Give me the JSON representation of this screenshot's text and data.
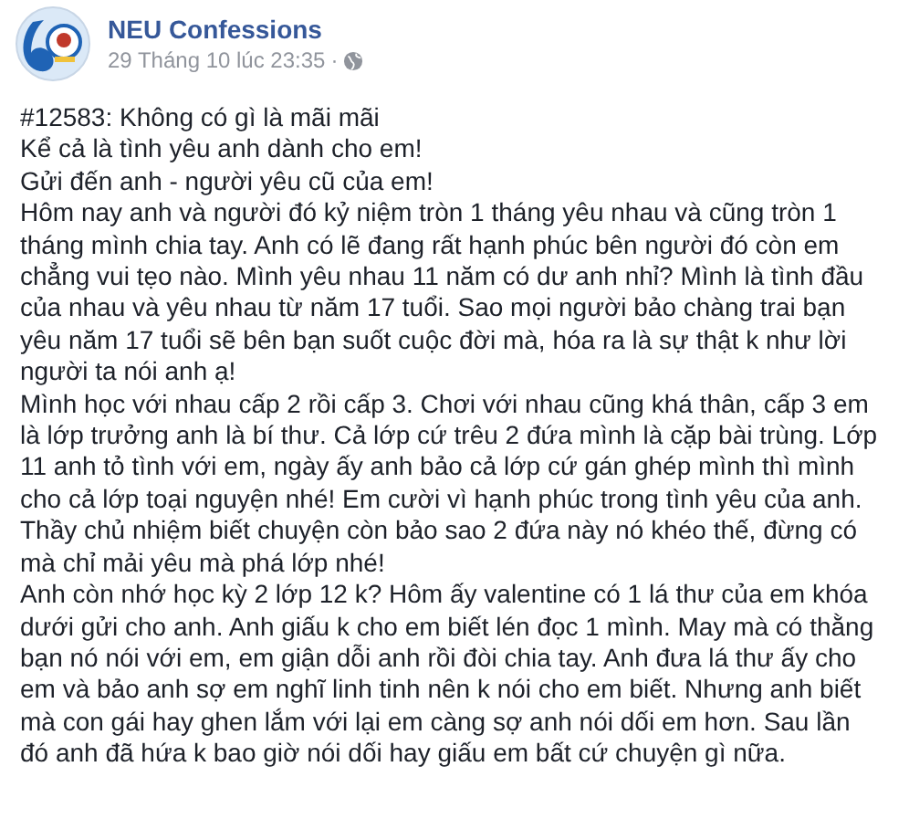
{
  "post": {
    "page_name": "NEU Confessions",
    "timestamp": "29 Tháng 10 lúc 23:35",
    "separator": "·",
    "paragraphs": [
      "#12583: Không có gì là mãi mãi",
      "Kể cả là tình yêu anh dành cho em!",
      "Gửi đến anh - người yêu cũ của em!",
      "Hôm nay anh và người đó kỷ niệm tròn 1 tháng yêu nhau và cũng tròn 1 tháng mình chia tay. Anh có lẽ đang rất hạnh phúc bên người đó còn em chẳng vui tẹo nào. Mình yêu nhau 11 năm có dư anh nhỉ? Mình là tình đầu của nhau và yêu nhau từ năm 17 tuổi. Sao mọi người bảo chàng trai bạn yêu năm 17 tuổi sẽ bên bạn suốt cuộc đời mà, hóa ra là sự thật k như lời người ta nói anh ạ!",
      "Mình học với nhau cấp 2 rồi cấp 3. Chơi với nhau cũng khá thân, cấp 3 em là lớp trưởng anh là bí thư. Cả lớp cứ trêu 2 đứa mình là cặp bài trùng. Lớp 11 anh tỏ tình với em, ngày ấy anh bảo cả lớp cứ gán ghép mình thì mình cho cả lớp toại nguyện nhé! Em cười vì hạnh phúc trong tình yêu của anh. Thầy chủ nhiệm biết chuyện còn bảo sao 2 đứa này nó khéo thế, đừng có mà chỉ mải yêu mà phá lớp nhé!",
      "Anh còn nhớ học kỳ 2 lớp 12 k? Hôm ấy valentine có 1 lá thư của em khóa dưới gửi cho anh. Anh giấu k cho em biết lén đọc 1 mình. May mà có thằng bạn nó nói với em, em giận dỗi anh rồi đòi chia tay. Anh đưa lá thư ấy cho em và bảo anh sợ em nghĩ linh tinh nên k nói cho em biết. Nhưng anh biết mà con gái hay ghen lắm với lại em càng sợ anh nói dối em hơn. Sau lần đó anh đã hứa k bao giờ nói dối hay giấu em bất cứ chuyện gì nữa."
    ]
  }
}
